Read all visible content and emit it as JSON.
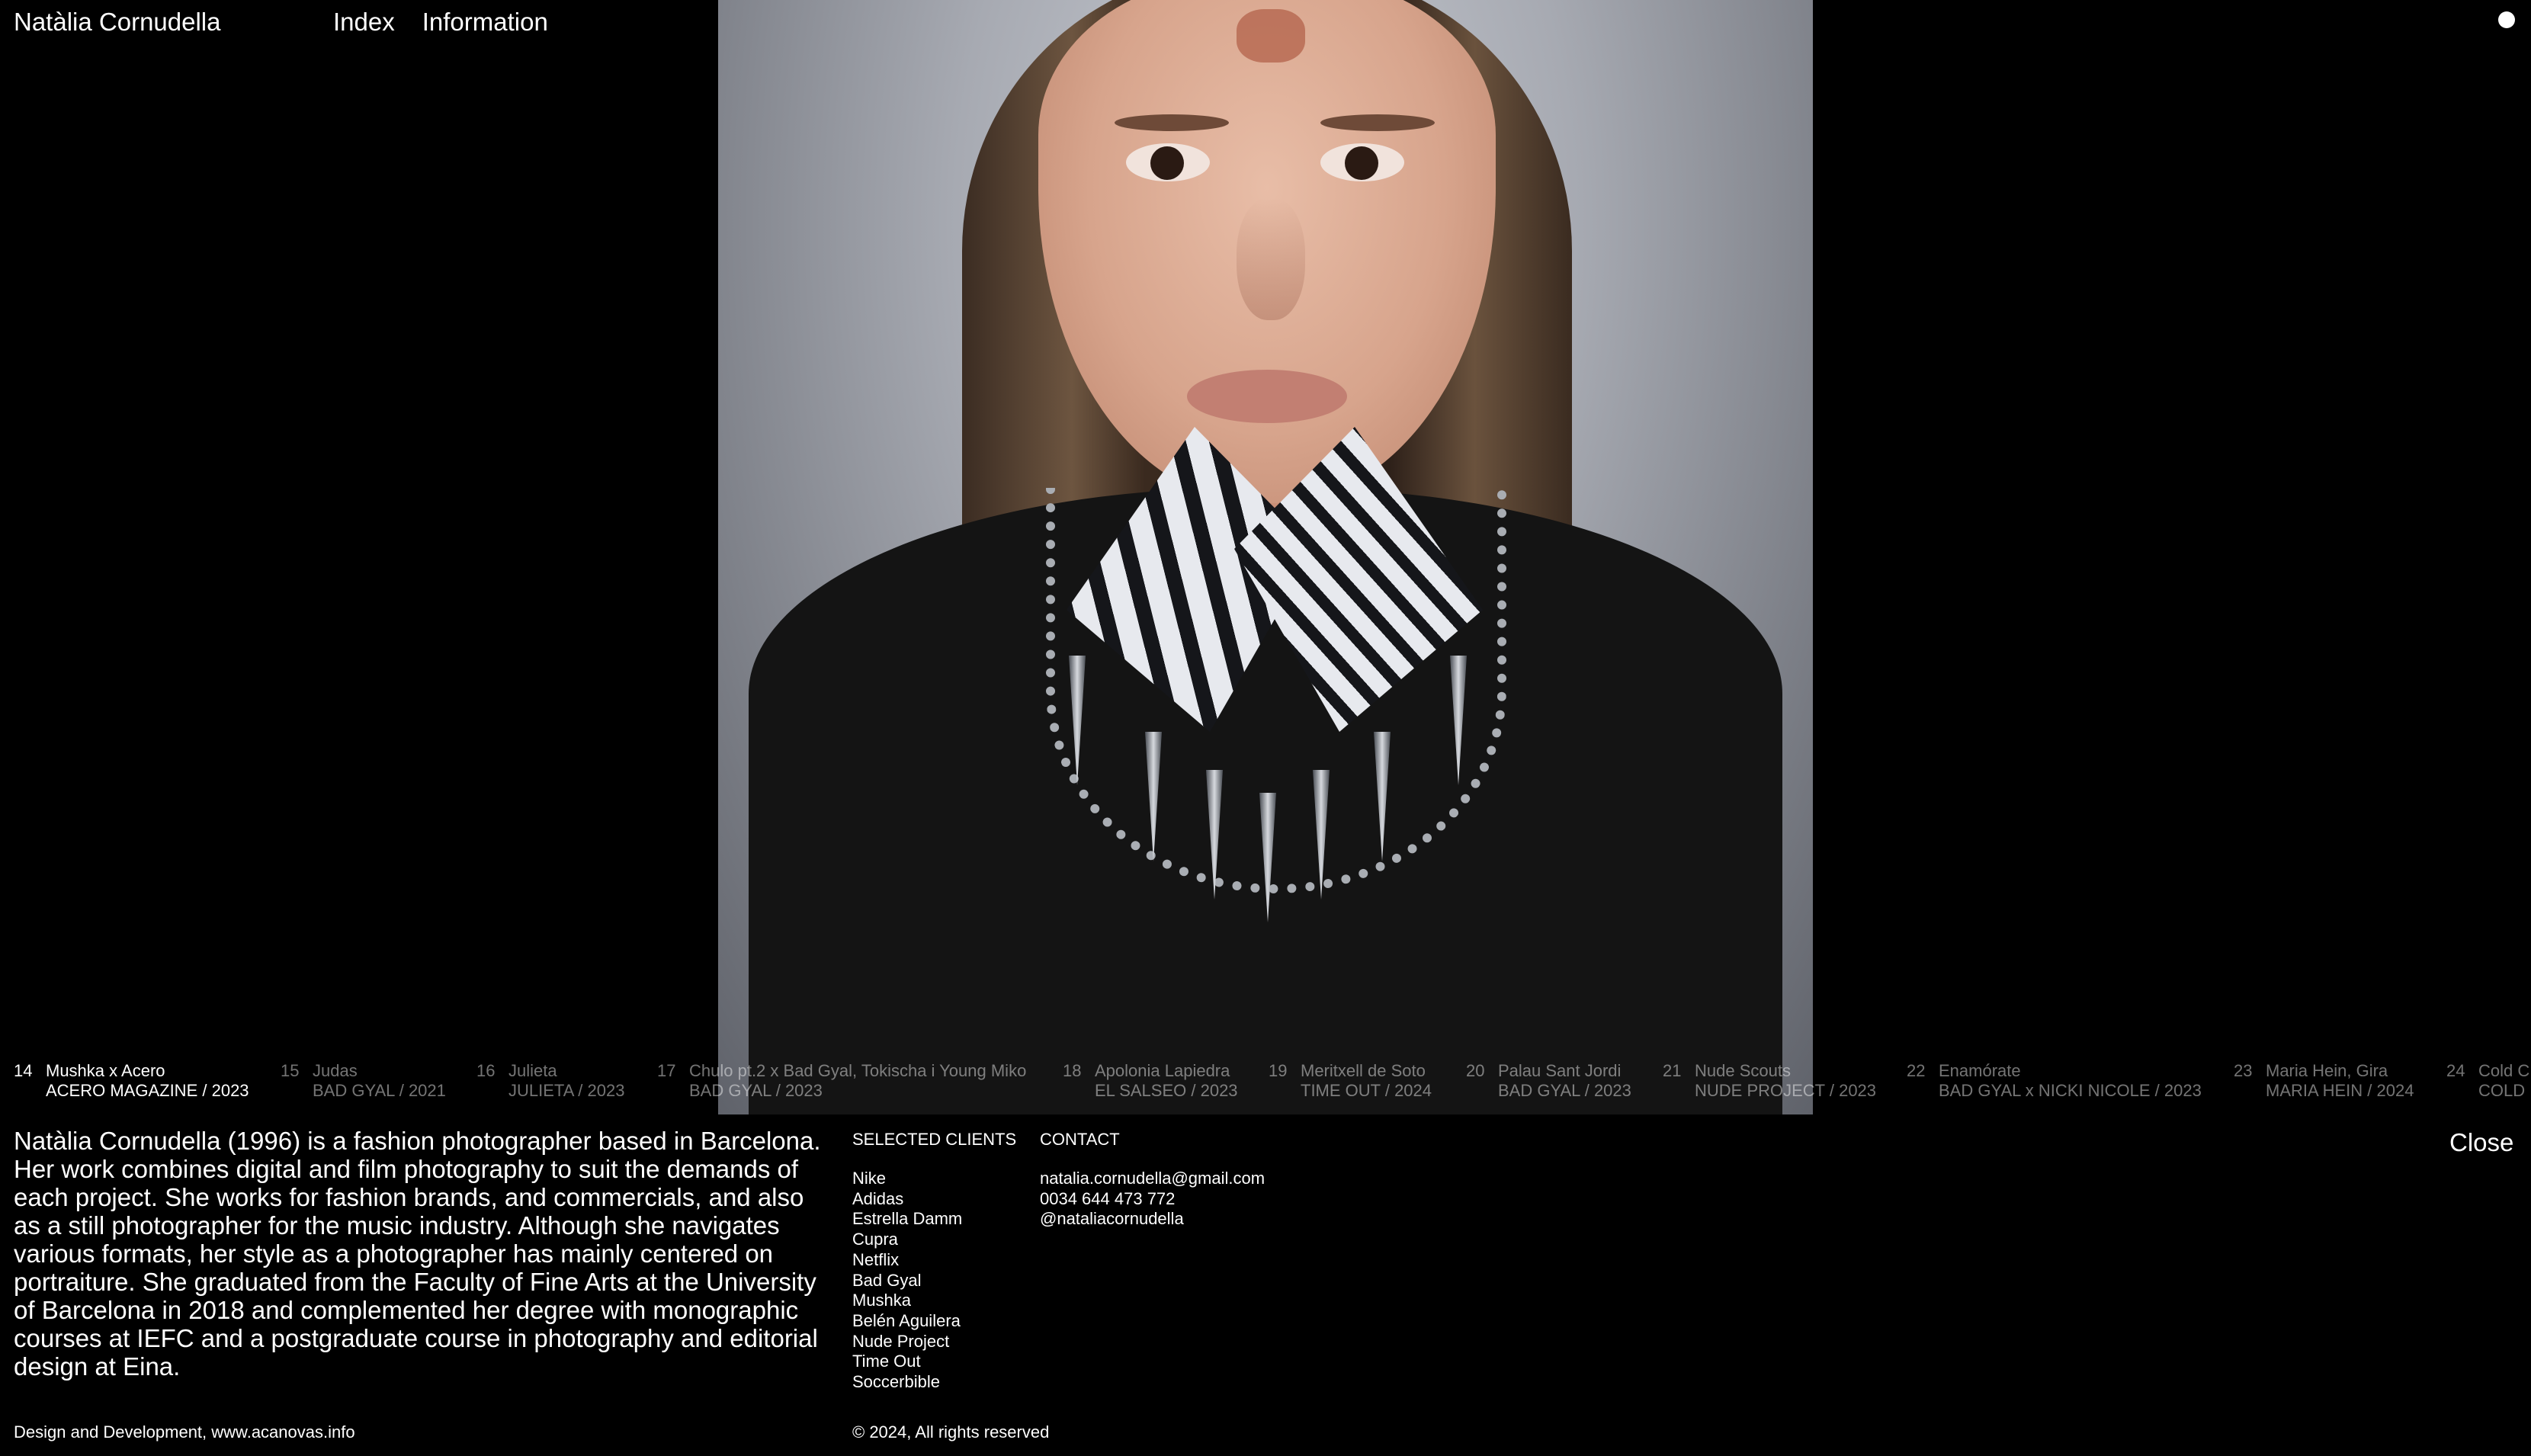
{
  "header": {
    "site_name": "Natàlia Cornudella",
    "nav": [
      "Index",
      "Information"
    ]
  },
  "projects": [
    {
      "num": "14",
      "title": "Mushka x Acero",
      "client": "ACERO MAGAZINE",
      "year": "2023",
      "active": true
    },
    {
      "num": "15",
      "title": "Judas",
      "client": "BAD GYAL",
      "year": "2021"
    },
    {
      "num": "16",
      "title": "Julieta",
      "client": "JULIETA",
      "year": "2023"
    },
    {
      "num": "17",
      "title": "Chulo pt.2 x Bad Gyal, Tokischa i Young Miko",
      "client": "BAD GYAL",
      "year": "2023"
    },
    {
      "num": "18",
      "title": "Apolonia Lapiedra",
      "client": "EL SALSEO",
      "year": "2023"
    },
    {
      "num": "19",
      "title": "Meritxell de Soto",
      "client": "TIME OUT",
      "year": "2024"
    },
    {
      "num": "20",
      "title": "Palau Sant Jordi",
      "client": "BAD GYAL",
      "year": "2023"
    },
    {
      "num": "21",
      "title": "Nude Scouts",
      "client": "NUDE PROJECT",
      "year": "2023"
    },
    {
      "num": "22",
      "title": "Enamórate",
      "client": "BAD GYAL x NICKI NICOLE",
      "year": "2023"
    },
    {
      "num": "23",
      "title": "Maria Hein, Gira",
      "client": "MARIA HEIN",
      "year": "2024"
    },
    {
      "num": "24",
      "title": "Cold C",
      "client": "COLD",
      "year": ""
    }
  ],
  "info": {
    "bio": "Natàlia Cornudella (1996) is a fashion photographer based in Barcelona. Her work combines digital and film photography to suit the demands of each project. She works for fashion brands, and commercials, and also as a still photographer for the music industry. Although she navigates various formats, her style as a photographer has mainly centered on portraiture. She graduated from the Faculty of Fine Arts at the University of Barcelona in 2018 and complemented her degree with monographic courses at IEFC and a postgraduate course in photography and editorial design at Eina.",
    "clients_heading": "SELECTED CLIENTS",
    "clients": [
      "Nike",
      "Adidas",
      "Estrella Damm",
      "Cupra",
      "Netflix",
      "Bad Gyal",
      "Mushka",
      "Belén Aguilera",
      "Nude Project",
      "Time Out",
      "Soccerbible"
    ],
    "contact_heading": "CONTACT",
    "contact": {
      "email": "natalia.cornudella@gmail.com",
      "phone": "0034 644 473 772",
      "instagram": "@nataliacornudella"
    },
    "close_label": "Close"
  },
  "footer": {
    "credit": "Design and Development, www.acanovas.info",
    "copyright": "© 2024, All rights reserved"
  }
}
